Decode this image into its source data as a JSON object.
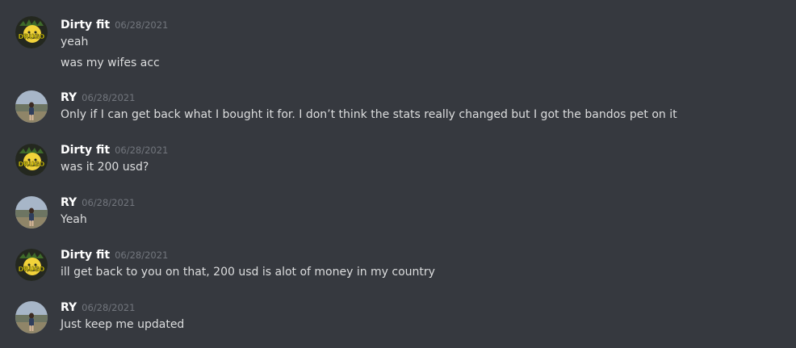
{
  "colors": {
    "background": "#36393f",
    "username": "#ffffff",
    "timestamp": "#72767d",
    "message_text": "#dcddde"
  },
  "users": {
    "dirty": {
      "name": "Dirty fit",
      "avatar_icon": "dirty-fit-avatar-icon",
      "avatar_text": "DRUGO"
    },
    "ry": {
      "name": "RY",
      "avatar_icon": "ry-avatar-icon"
    }
  },
  "messages": [
    {
      "username": "Dirty fit",
      "timestamp": "06/28/2021",
      "lines": [
        "yeah",
        "was my wifes acc"
      ]
    },
    {
      "username": "RY",
      "timestamp": "06/28/2021",
      "lines": [
        "Only if I can get back what I bought it for. I don’t think the stats really changed but I got the bandos pet on it"
      ]
    },
    {
      "username": "Dirty fit",
      "timestamp": "06/28/2021",
      "lines": [
        "was it 200 usd?"
      ]
    },
    {
      "username": "RY",
      "timestamp": "06/28/2021",
      "lines": [
        "Yeah"
      ]
    },
    {
      "username": "Dirty fit",
      "timestamp": "06/28/2021",
      "lines": [
        "ill get back to you on that, 200 usd is alot of money in my country"
      ]
    },
    {
      "username": "RY",
      "timestamp": "06/28/2021",
      "lines": [
        "Just keep me updated"
      ]
    }
  ]
}
